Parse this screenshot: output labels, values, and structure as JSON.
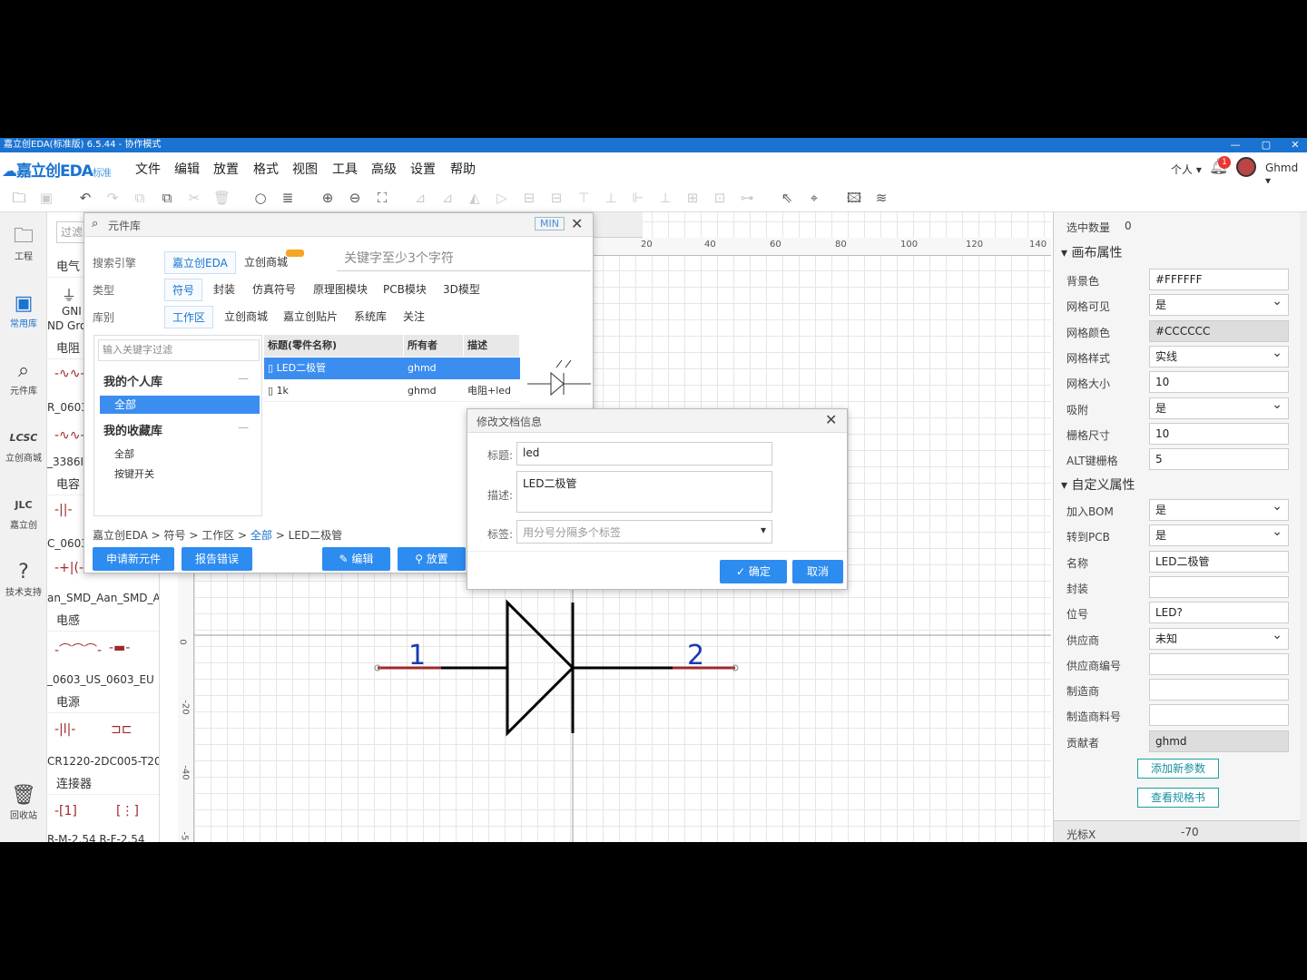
{
  "window": {
    "title": "嘉立创EDA(标准版) 6.5.44 - 协作模式",
    "minimize": "—",
    "maximize": "▢",
    "close": "✕"
  },
  "logo": {
    "brand": "嘉立创EDA",
    "edition": "标准"
  },
  "menu": [
    "文件",
    "编辑",
    "放置",
    "格式",
    "视图",
    "工具",
    "高级",
    "设置",
    "帮助"
  ],
  "user": {
    "mode": "个人",
    "notifications": "1",
    "name": "Ghmd"
  },
  "leftnav": [
    {
      "label": "工程",
      "icon": "folder-icon"
    },
    {
      "label": "常用库",
      "icon": "chip-icon"
    },
    {
      "label": "元件库",
      "icon": "search-icon"
    },
    {
      "label": "立创商城",
      "icon": "lcsc-icon"
    },
    {
      "label": "嘉立创",
      "icon": "jlc-icon"
    },
    {
      "label": "技术支持",
      "icon": "help-icon"
    },
    {
      "label": "回收站",
      "icon": "trash-icon"
    }
  ],
  "libpanel": {
    "filter_placeholder": "过滤",
    "sections": [
      "电气",
      "电阻",
      "电容",
      "电感",
      "电源",
      "连接器"
    ],
    "items": {
      "gnd1": "GNI",
      "gnd2": "ND Gro",
      "r1": "R_0603",
      "r2": "_3386I",
      "c1": "C_0603",
      "c2": "an_SMD_Aan_SMD_A",
      "l1": "_0603_US_0603_EU",
      "p1": "CR1220-2DC005-T20",
      "k1": "R-M-2.54 R-F-2.54"
    }
  },
  "complib": {
    "title": "元件库",
    "min": "MIN",
    "search_engine_label": "搜索引擎",
    "engines": [
      "嘉立创EDA",
      "立创商城"
    ],
    "search_placeholder": "关键字至少3个字符",
    "type_label": "类型",
    "types": [
      "符号",
      "封装",
      "仿真符号",
      "原理图模块",
      "PCB模块",
      "3D模型"
    ],
    "lib_label": "库别",
    "libs": [
      "工作区",
      "立创商城",
      "嘉立创贴片",
      "系统库",
      "关注"
    ],
    "filter_placeholder": "输入关键字过滤",
    "my_lib": "我的个人库",
    "all": "全部",
    "my_fav": "我的收藏库",
    "fav_all": "全部",
    "fav_switch": "按键开关",
    "columns": [
      "标题(零件名称)",
      "所有者",
      "描述"
    ],
    "rows": [
      {
        "title": "LED二极管",
        "owner": "ghmd",
        "desc": ""
      },
      {
        "title": "1k",
        "owner": "ghmd",
        "desc": "电阻+led"
      }
    ],
    "breadcrumb": [
      "嘉立创EDA",
      "符号",
      "工作区",
      "全部",
      "LED二极管"
    ],
    "buttons": {
      "apply": "申请新元件",
      "report": "报告错误",
      "edit": "编辑",
      "place": "放置"
    }
  },
  "docdlg": {
    "title": "修改文档信息",
    "title_label": "标题:",
    "title_value": "led",
    "desc_label": "描述:",
    "desc_value": "LED二极管",
    "tag_label": "标签:",
    "tag_placeholder": "用分号分隔多个标签",
    "ok": "确定",
    "cancel": "取消"
  },
  "canvas": {
    "hruler": [
      "20",
      "40",
      "60",
      "80",
      "100",
      "120",
      "140"
    ],
    "vruler": [
      "0",
      "-20",
      "-40",
      "-5"
    ],
    "pin1": "1",
    "pin2": "2"
  },
  "rightpanel": {
    "selected_label": "选中数量",
    "selected_value": "0",
    "canvas_section": "画布属性",
    "canvas_props": [
      {
        "label": "背景色",
        "value": "#FFFFFF",
        "kind": "text"
      },
      {
        "label": "网格可见",
        "value": "是",
        "kind": "select"
      },
      {
        "label": "网格颜色",
        "value": "#CCCCCC",
        "kind": "gray"
      },
      {
        "label": "网格样式",
        "value": "实线",
        "kind": "select"
      },
      {
        "label": "网格大小",
        "value": "10",
        "kind": "text"
      },
      {
        "label": "吸附",
        "value": "是",
        "kind": "select"
      },
      {
        "label": "栅格尺寸",
        "value": "10",
        "kind": "text"
      },
      {
        "label": "ALT键栅格",
        "value": "5",
        "kind": "text"
      }
    ],
    "custom_section": "自定义属性",
    "custom_props": [
      {
        "label": "加入BOM",
        "value": "是",
        "kind": "select"
      },
      {
        "label": "转到PCB",
        "value": "是",
        "kind": "select"
      },
      {
        "label": "名称",
        "value": "LED二极管",
        "kind": "text"
      },
      {
        "label": "封装",
        "value": "",
        "kind": "text"
      },
      {
        "label": "位号",
        "value": "LED?",
        "kind": "text"
      },
      {
        "label": "供应商",
        "value": "未知",
        "kind": "select"
      },
      {
        "label": "供应商编号",
        "value": "",
        "kind": "text"
      },
      {
        "label": "制造商",
        "value": "",
        "kind": "text"
      },
      {
        "label": "制造商料号",
        "value": "",
        "kind": "text"
      },
      {
        "label": "贡献者",
        "value": "ghmd",
        "kind": "gray"
      }
    ],
    "add_param": "添加新参数",
    "view_spec": "查看规格书",
    "cursor_label": "光标X",
    "cursor_value": "-70"
  },
  "colors": {
    "accent": "#1a73d0",
    "button": "#2d8cf0",
    "selected_row": "#3b8ef0",
    "pin": "#a0282a"
  }
}
